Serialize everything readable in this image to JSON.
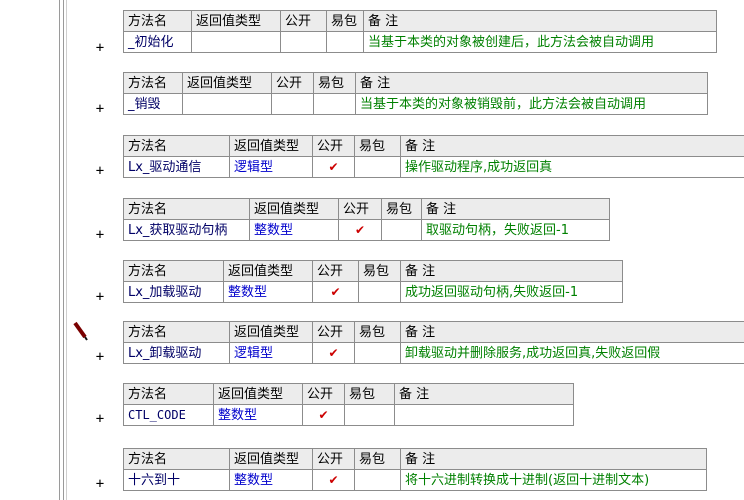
{
  "headers": {
    "method": "方法名",
    "return_type": "返回值类型",
    "public": "公开",
    "easy_pack": "易包",
    "remark": "备 注"
  },
  "check_mark": "✔",
  "expand_symbol": "+",
  "methods": [
    {
      "name": "_初始化",
      "return_type": "",
      "public": false,
      "easy_pack": false,
      "remark": "当基于本类的对象被创建后，此方法会被自动调用"
    },
    {
      "name": "_销毁",
      "return_type": "",
      "public": false,
      "easy_pack": false,
      "remark": "当基于本类的对象被销毁前，此方法会被自动调用"
    },
    {
      "name": "Lx_驱动通信",
      "return_type": "逻辑型",
      "public": true,
      "easy_pack": false,
      "remark": "操作驱动程序,成功返回真"
    },
    {
      "name": "Lx_获取驱动句柄",
      "return_type": "整数型",
      "public": true,
      "easy_pack": false,
      "remark": "取驱动句柄，失败返回-1"
    },
    {
      "name": "Lx_加载驱动",
      "return_type": "整数型",
      "public": true,
      "easy_pack": false,
      "remark": "成功返回驱动句柄,失败返回-1"
    },
    {
      "name": "Lx_卸载驱动",
      "return_type": "逻辑型",
      "public": true,
      "easy_pack": false,
      "remark": "卸载驱动并删除服务,成功返回真,失败返回假"
    },
    {
      "name": "CTL_CODE",
      "return_type": "整数型",
      "public": true,
      "easy_pack": false,
      "remark": ""
    },
    {
      "name": "十六到十",
      "return_type": "整数型",
      "public": true,
      "easy_pack": false,
      "remark": "将十六进制转换成十进制(返回十进制文本)"
    }
  ],
  "colors": {
    "name_text": "#000066",
    "return_type_text": "#0000cc",
    "remark_text": "#008000",
    "check_mark": "#cc0000",
    "header_bg": "#ececec",
    "border": "#8c8c8c"
  },
  "icons": {
    "edit": "pencil-icon"
  }
}
